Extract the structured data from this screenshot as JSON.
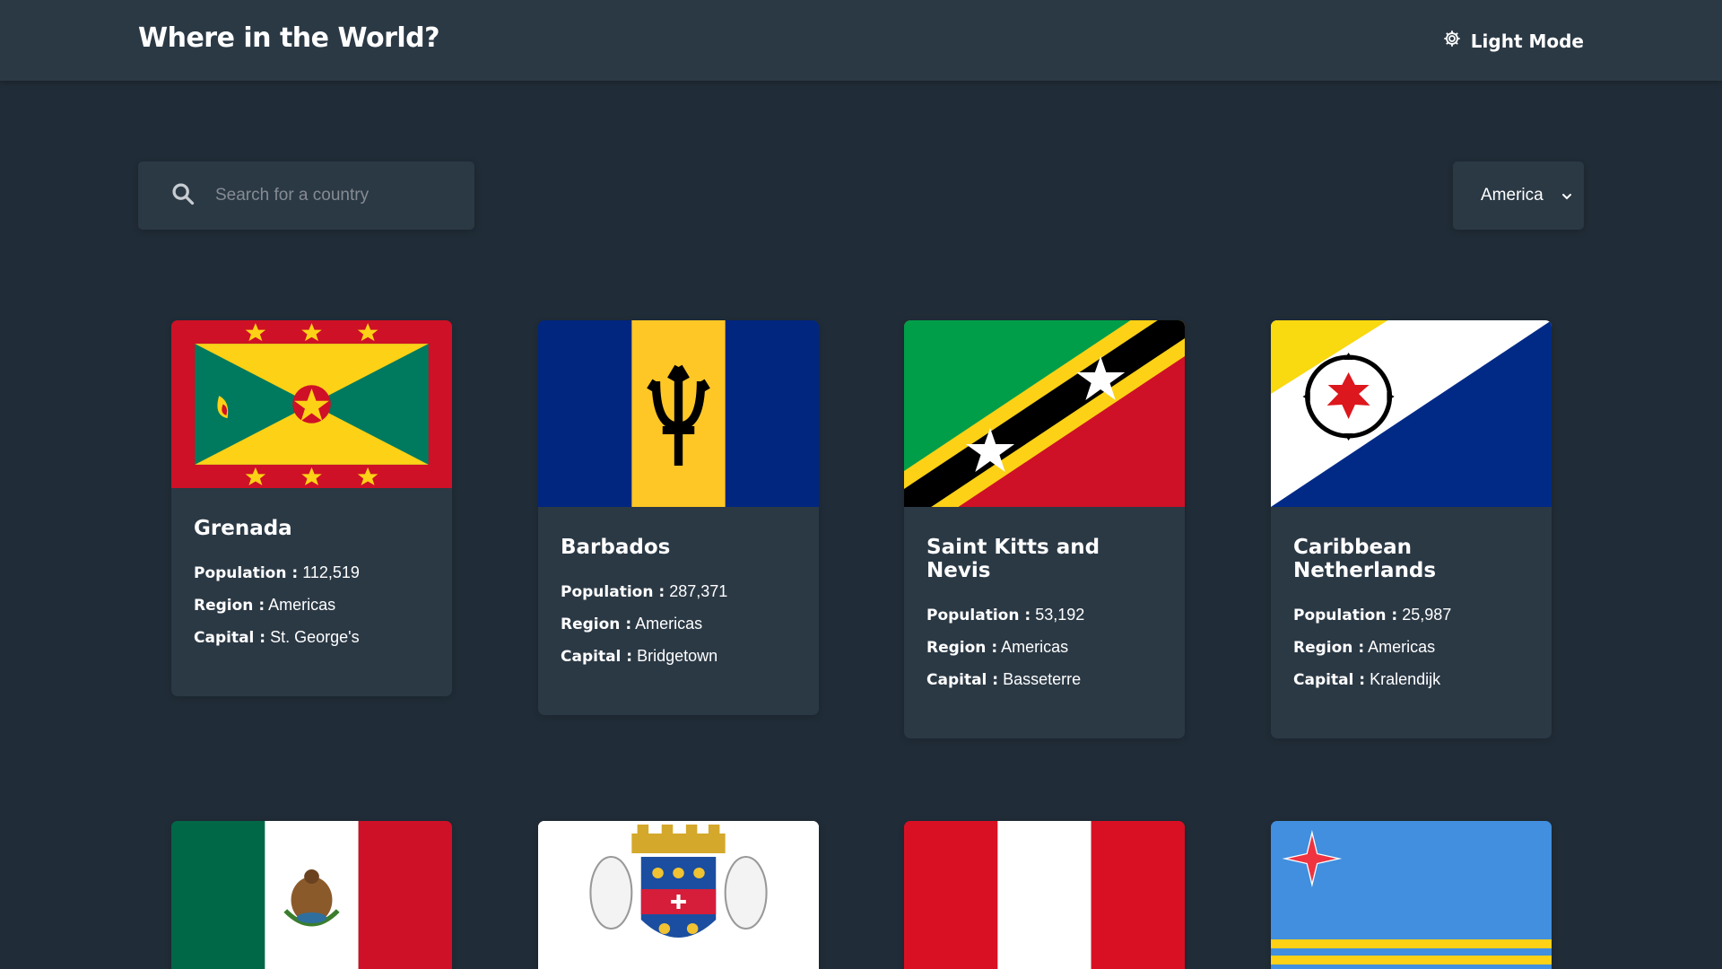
{
  "header": {
    "title": "Where in the World?",
    "theme_label": "Light Mode"
  },
  "search": {
    "placeholder": "Search for a country"
  },
  "filter": {
    "selected": "America"
  },
  "labels": {
    "population": "Population :",
    "region": "Region :",
    "capital": "Capital :"
  },
  "countries": [
    {
      "name": "Grenada",
      "population": "112,519",
      "region": "Americas",
      "capital": "St. George's",
      "flag_icon": "grenada-flag"
    },
    {
      "name": "Barbados",
      "population": "287,371",
      "region": "Americas",
      "capital": "Bridgetown",
      "flag_icon": "barbados-flag"
    },
    {
      "name": "Saint Kitts and Nevis",
      "population": "53,192",
      "region": "Americas",
      "capital": "Basseterre",
      "flag_icon": "saint-kitts-flag"
    },
    {
      "name": "Caribbean Netherlands",
      "population": "25,987",
      "region": "Americas",
      "capital": "Kralendijk",
      "flag_icon": "bonaire-flag"
    },
    {
      "flag_icon": "mexico-flag"
    },
    {
      "flag_icon": "saint-barthelemy-flag"
    },
    {
      "flag_icon": "peru-flag"
    },
    {
      "flag_icon": "aruba-flag"
    }
  ],
  "colors": {
    "background": "#202c37",
    "surface": "#2b3945",
    "text": "#ffffff",
    "placeholder": "#858b93"
  }
}
